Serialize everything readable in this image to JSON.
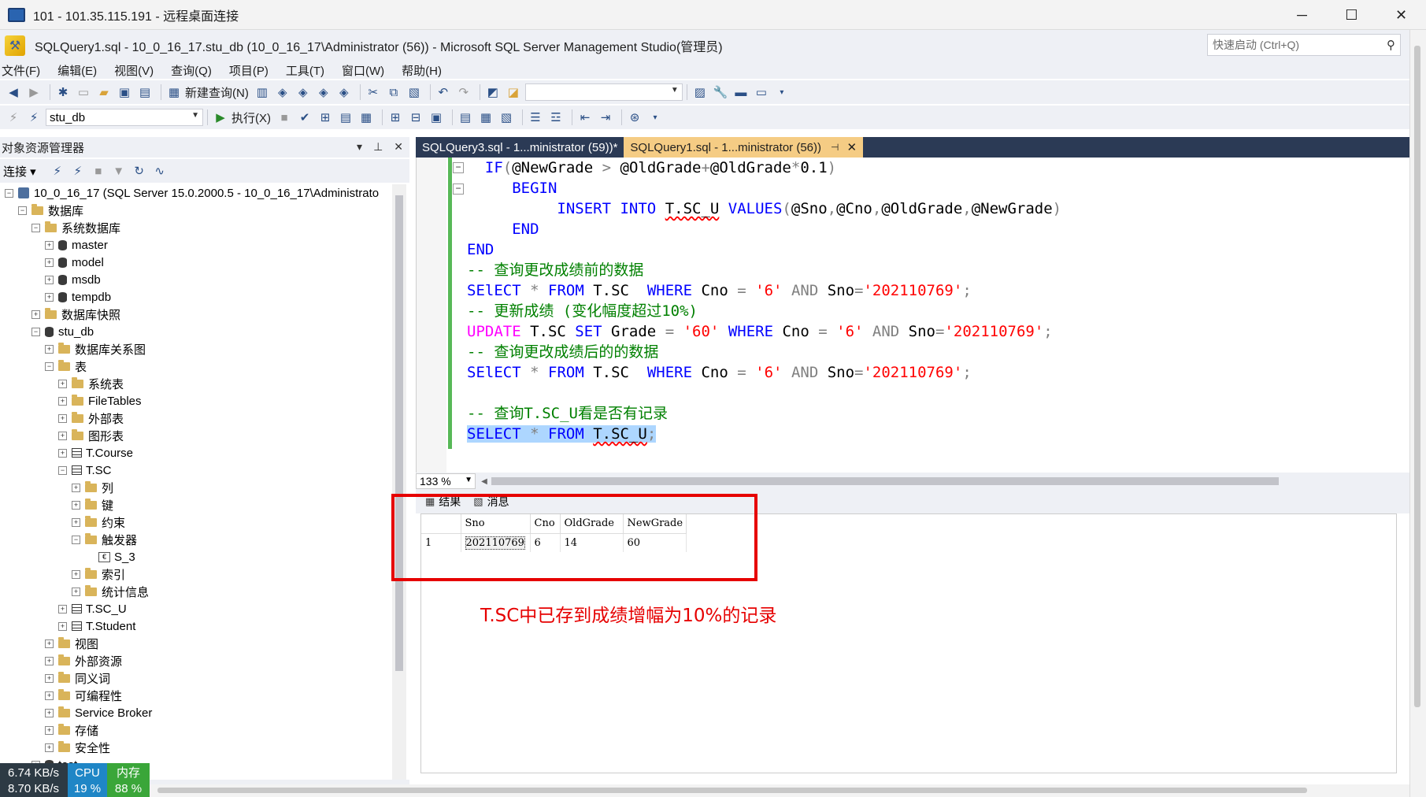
{
  "rdp": {
    "title": "101 - 101.35.115.191 - 远程桌面连接",
    "minimize": "─",
    "maximize": "☐",
    "close": "✕"
  },
  "ssms": {
    "title": "SQLQuery1.sql - 10_0_16_17.stu_db (10_0_16_17\\Administrator (56)) - Microsoft SQL Server Management Studio(管理员)",
    "quick_launch_placeholder": "快速启动 (Ctrl+Q)"
  },
  "menu": [
    "文件(F)",
    "编辑(E)",
    "视图(V)",
    "查询(Q)",
    "项目(P)",
    "工具(T)",
    "窗口(W)",
    "帮助(H)"
  ],
  "toolbar": {
    "new_query": "新建查询(N)",
    "execute": "执行(X)",
    "database": "stu_db"
  },
  "object_explorer": {
    "title": "对象资源管理器",
    "connect": "连接",
    "tree": [
      {
        "label": "10_0_16_17 (SQL Server 15.0.2000.5 - 10_0_16_17\\Administrato",
        "indent": 0,
        "exp": "−",
        "icon": "server"
      },
      {
        "label": "数据库",
        "indent": 1,
        "exp": "−",
        "icon": "folder"
      },
      {
        "label": "系统数据库",
        "indent": 2,
        "exp": "−",
        "icon": "folder"
      },
      {
        "label": "master",
        "indent": 3,
        "exp": "+",
        "icon": "db"
      },
      {
        "label": "model",
        "indent": 3,
        "exp": "+",
        "icon": "db"
      },
      {
        "label": "msdb",
        "indent": 3,
        "exp": "+",
        "icon": "db"
      },
      {
        "label": "tempdb",
        "indent": 3,
        "exp": "+",
        "icon": "db"
      },
      {
        "label": "数据库快照",
        "indent": 2,
        "exp": "+",
        "icon": "folder"
      },
      {
        "label": "stu_db",
        "indent": 2,
        "exp": "−",
        "icon": "db"
      },
      {
        "label": "数据库关系图",
        "indent": 3,
        "exp": "+",
        "icon": "folder"
      },
      {
        "label": "表",
        "indent": 3,
        "exp": "−",
        "icon": "folder"
      },
      {
        "label": "系统表",
        "indent": 4,
        "exp": "+",
        "icon": "folder"
      },
      {
        "label": "FileTables",
        "indent": 4,
        "exp": "+",
        "icon": "folder"
      },
      {
        "label": "外部表",
        "indent": 4,
        "exp": "+",
        "icon": "folder"
      },
      {
        "label": "图形表",
        "indent": 4,
        "exp": "+",
        "icon": "folder"
      },
      {
        "label": "T.Course",
        "indent": 4,
        "exp": "+",
        "icon": "table"
      },
      {
        "label": "T.SC",
        "indent": 4,
        "exp": "−",
        "icon": "table"
      },
      {
        "label": "列",
        "indent": 5,
        "exp": "+",
        "icon": "folder"
      },
      {
        "label": "键",
        "indent": 5,
        "exp": "+",
        "icon": "folder"
      },
      {
        "label": "约束",
        "indent": 5,
        "exp": "+",
        "icon": "folder"
      },
      {
        "label": "触发器",
        "indent": 5,
        "exp": "−",
        "icon": "folder"
      },
      {
        "label": "S_3",
        "indent": 6,
        "exp": "",
        "icon": "trigger"
      },
      {
        "label": "索引",
        "indent": 5,
        "exp": "+",
        "icon": "folder"
      },
      {
        "label": "统计信息",
        "indent": 5,
        "exp": "+",
        "icon": "folder"
      },
      {
        "label": "T.SC_U",
        "indent": 4,
        "exp": "+",
        "icon": "table"
      },
      {
        "label": "T.Student",
        "indent": 4,
        "exp": "+",
        "icon": "table"
      },
      {
        "label": "视图",
        "indent": 3,
        "exp": "+",
        "icon": "folder"
      },
      {
        "label": "外部资源",
        "indent": 3,
        "exp": "+",
        "icon": "folder"
      },
      {
        "label": "同义词",
        "indent": 3,
        "exp": "+",
        "icon": "folder"
      },
      {
        "label": "可编程性",
        "indent": 3,
        "exp": "+",
        "icon": "folder"
      },
      {
        "label": "Service Broker",
        "indent": 3,
        "exp": "+",
        "icon": "folder"
      },
      {
        "label": "存储",
        "indent": 3,
        "exp": "+",
        "icon": "folder"
      },
      {
        "label": "安全性",
        "indent": 3,
        "exp": "+",
        "icon": "folder"
      },
      {
        "label": "test",
        "indent": 2,
        "exp": "+",
        "icon": "db"
      }
    ]
  },
  "net_widget": {
    "upload": "6.74 KB/s",
    "download": "8.70 KB/s",
    "cpu_label": "CPU",
    "cpu_value": "19 %",
    "mem_label": "内存",
    "mem_value": "88 %"
  },
  "editor": {
    "tabs": [
      {
        "label": "SQLQuery3.sql - 1...ministrator (59))*",
        "active": false
      },
      {
        "label": "SQLQuery1.sql - 1...ministrator (56))",
        "active": true
      }
    ],
    "zoom": "133 %"
  },
  "results": {
    "tab_results": "结果",
    "tab_messages": "消息",
    "columns": [
      "Sno",
      "Cno",
      "OldGrade",
      "NewGrade"
    ],
    "rows": [
      {
        "n": "1",
        "cells": [
          "202110769",
          "6",
          "14",
          "60"
        ]
      }
    ]
  },
  "annotation": "T.SC中已存到成绩增幅为10%的记录",
  "colors": {
    "accent_tab": "#f5cc84",
    "tab_bar": "#2b3a55",
    "annotation_red": "#e60000"
  }
}
